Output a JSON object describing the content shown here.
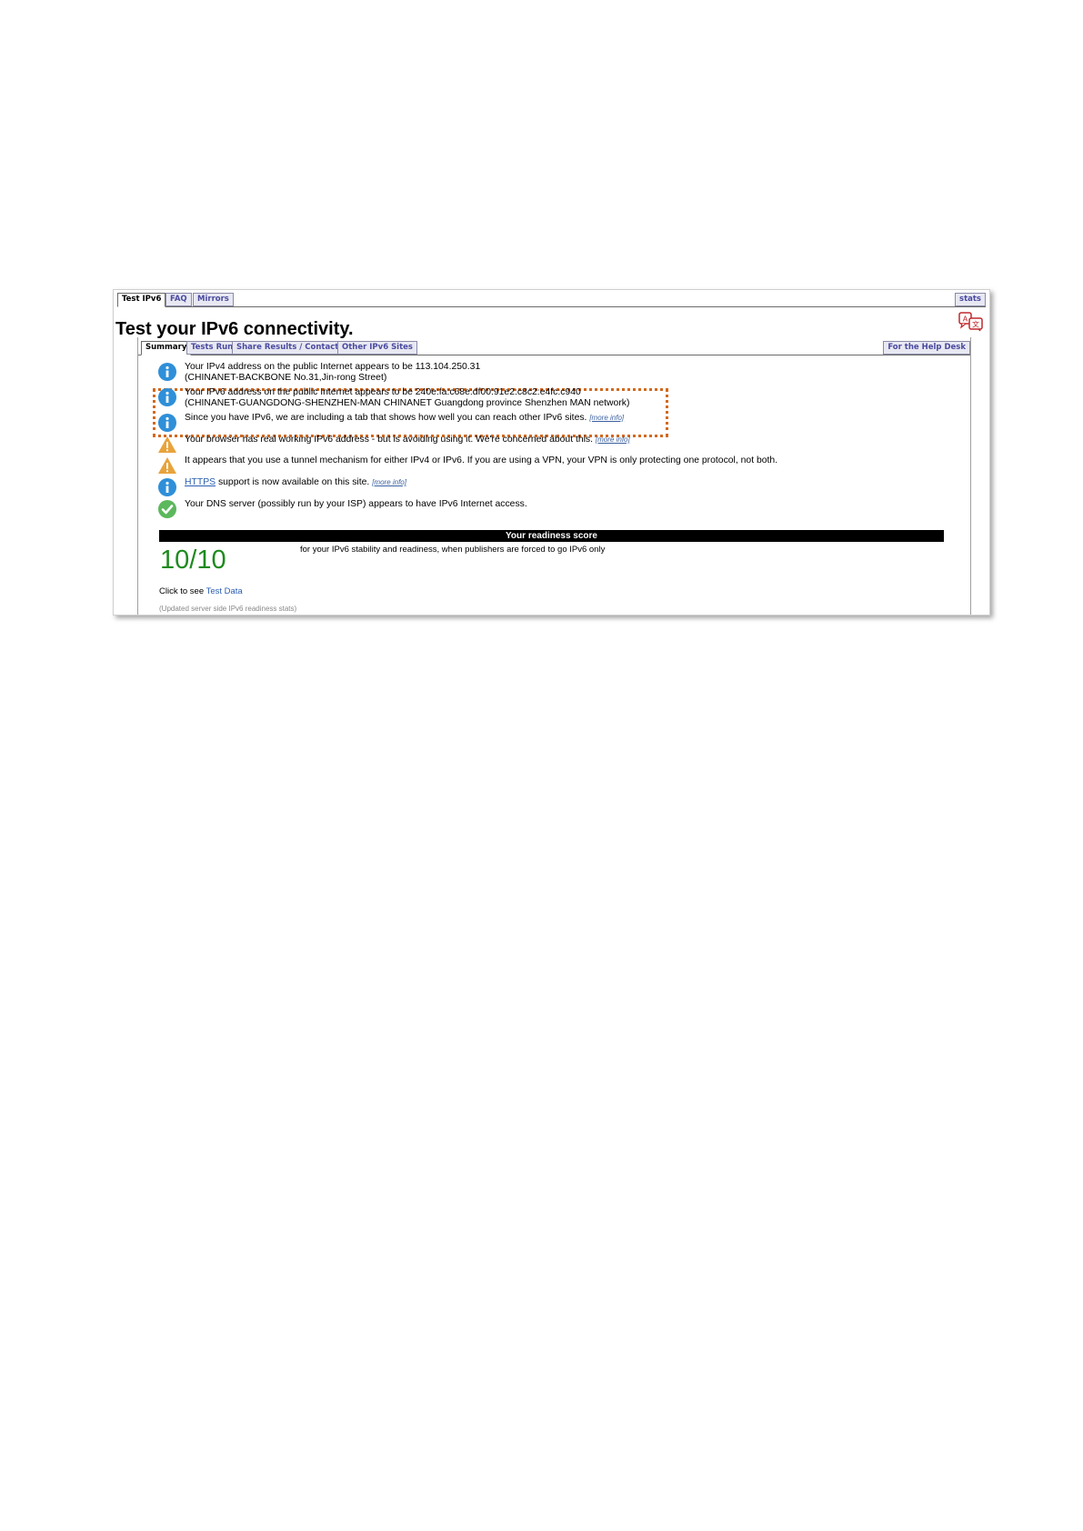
{
  "top_tabs": [
    "Test IPv6",
    "FAQ",
    "Mirrors"
  ],
  "stats_tab": "stats",
  "page_title": "Test your IPv6 connectivity.",
  "inner_tabs": [
    "Summary",
    "Tests Run",
    "Share Results / Contact",
    "Other IPv6 Sites"
  ],
  "help_desk_tab": "For the Help Desk",
  "messages": {
    "ipv4_line1": "Your IPv4 address on the public Internet appears to be 113.104.250.31",
    "ipv4_line2": "(CHINANET-BACKBONE No.31,Jin-rong Street)",
    "ipv6_line1": "Your IPv6 address on the public Internet appears to be 240e:fa:c68e:df00:91e2:c8c2:e4fc:c940",
    "ipv6_line2": "(CHINANET-GUANGDONG-SHENZHEN-MAN CHINANET Guangdong province Shenzhen MAN network)",
    "tab_note": "Since you have IPv6, we are including a tab that shows how well you can reach other IPv6 sites.",
    "avoiding": "Your browser has real working IPv6 address - but is avoiding using it. We're concerned about this.",
    "tunnel": "It appears that you use a tunnel mechanism for either IPv4 or IPv6. If you are using a VPN, your VPN is only protecting one protocol, not both.",
    "https_link": "HTTPS",
    "https_rest": " support is now available on this site.",
    "dns": "Your DNS server (possibly run by your ISP) appears to have IPv6 Internet access."
  },
  "more_info": "[more info]",
  "readiness_header": "Your readiness score",
  "score": "10/10",
  "score_desc": "for your IPv6 stability and readiness, when publishers are forced to go IPv6 only",
  "click_to_see": "Click to see ",
  "test_data_link": "Test Data",
  "updated_note": "(Updated server side IPv6 readiness stats)",
  "colors": {
    "info_blue": "#2f8fd8",
    "warning_orange": "#e8a33c",
    "ok_green": "#5cb85c",
    "score_green": "#1e8a1e",
    "highlight": "#d2691e"
  }
}
